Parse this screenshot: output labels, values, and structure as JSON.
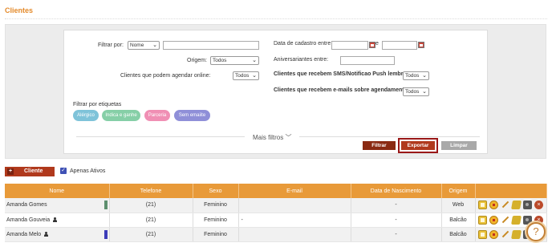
{
  "page": {
    "title": "Clientes"
  },
  "filters": {
    "filtrar_por": {
      "label": "Filtrar por:",
      "value": "Nome",
      "text_value": ""
    },
    "origem": {
      "label": "Origem:",
      "value": "Todos"
    },
    "agendar_online": {
      "label": "Clientes que podem agendar online:",
      "value": "Todos"
    },
    "data_cadastro": {
      "label": "Data de cadastro entre",
      "sep": "e"
    },
    "aniversariantes": {
      "label": "Aniversariantes entre:"
    },
    "sms_push": {
      "label": "Clientes que recebem SMS/Notificao Push lembrete:",
      "value": "Todos"
    },
    "emails": {
      "label": "Clientes que recebem e-mails sobre agendamentos:",
      "value": "Todos"
    },
    "tags_label": "Filtrar por etiquetas",
    "tags": [
      {
        "label": "Alérgico",
        "color": "#7fc3d9"
      },
      {
        "label": "Indica e ganhe",
        "color": "#86cfa7"
      },
      {
        "label": "Parceria",
        "color": "#f08fb4"
      },
      {
        "label": "Sem emaiite",
        "color": "#8f8fd8"
      }
    ],
    "more_label": "Mais filtros",
    "buttons": {
      "filtrar": "Filtrar",
      "exportar": "Exportar",
      "limpar": "Limpar"
    }
  },
  "toolbar": {
    "new_client": "Cliente",
    "active_only": "Apenas Ativos"
  },
  "table": {
    "columns": [
      "Nome",
      "Telefone",
      "Sexo",
      "E-mail",
      "Data de Nascimento",
      "Origem",
      ""
    ],
    "rows": [
      {
        "nome": "Amanda Gomes",
        "telefone": "(21)",
        "sexo": "Feminino",
        "email": "",
        "nascimento": "-",
        "origem": "Web",
        "strip": "#5d8f6e",
        "person": false
      },
      {
        "nome": "Amanda Gouveia",
        "telefone": "(21)",
        "sexo": "Feminino",
        "email": "-",
        "nascimento": "-",
        "origem": "Balcão",
        "strip": "",
        "person": true
      },
      {
        "nome": "Amanda Melo",
        "telefone": "(21)",
        "sexo": "Feminino",
        "email": "",
        "nascimento": "-",
        "origem": "Balcão",
        "strip": "#3c3cb8",
        "person": true
      }
    ]
  },
  "help": {
    "label": "?"
  },
  "colors": {
    "accent": "#e89a39",
    "title": "#e48a2a",
    "filtrar": "#8a2a12",
    "exportar": "#b0391c",
    "limpar": "#a9a9a9"
  }
}
